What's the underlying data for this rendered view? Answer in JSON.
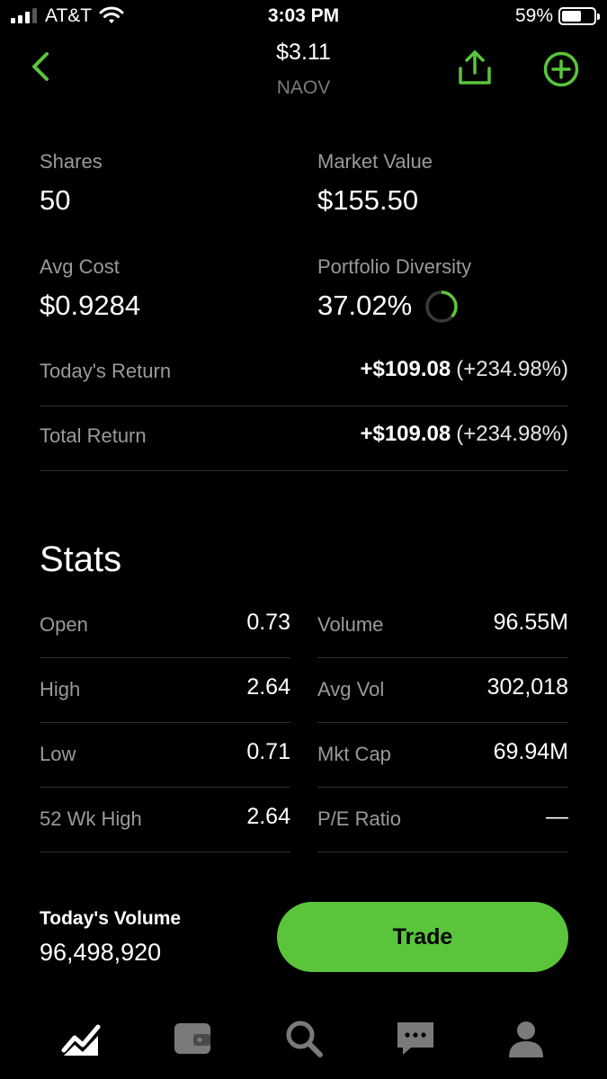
{
  "status_bar": {
    "carrier": "AT&T",
    "time": "3:03 PM",
    "battery": "59%",
    "battery_level": 0.59,
    "icons": [
      "signal-icon",
      "wifi-icon",
      "battery-icon"
    ]
  },
  "header": {
    "price": "$3.11",
    "symbol": "NAOV",
    "icons": [
      "back-chevron-icon",
      "share-icon",
      "add-circle-icon"
    ],
    "accent_color": "#5ac53b"
  },
  "position": {
    "shares_label": "Shares",
    "shares_value": "50",
    "market_value_label": "Market Value",
    "market_value": "$155.50",
    "avg_cost_label": "Avg Cost",
    "avg_cost": "$0.9284",
    "diversity_label": "Portfolio Diversity",
    "diversity_value": "37.02%",
    "diversity_fraction": 0.3702,
    "todays_return_label": "Today's Return",
    "todays_return_amount": "+$109.08",
    "todays_return_pct": "(+234.98%)",
    "total_return_label": "Total Return",
    "total_return_amount": "+$109.08",
    "total_return_pct": "(+234.98%)"
  },
  "stats": {
    "title": "Stats",
    "left": [
      {
        "label": "Open",
        "value": "0.73"
      },
      {
        "label": "High",
        "value": "2.64"
      },
      {
        "label": "Low",
        "value": "0.71"
      },
      {
        "label": "52 Wk High",
        "value": "2.64"
      }
    ],
    "right": [
      {
        "label": "Volume",
        "value": "96.55M"
      },
      {
        "label": "Avg Vol",
        "value": "302,018"
      },
      {
        "label": "Mkt Cap",
        "value": "69.94M"
      },
      {
        "label": "P/E Ratio",
        "value": "—"
      }
    ]
  },
  "footer": {
    "volume_label": "Today's Volume",
    "volume_value": "96,498,920",
    "trade_label": "Trade",
    "trade_color": "#5ac53b"
  },
  "tab_bar": {
    "tabs": [
      "chart-icon",
      "wallet-icon",
      "search-icon",
      "messages-icon",
      "account-icon"
    ],
    "active": "chart-icon"
  }
}
